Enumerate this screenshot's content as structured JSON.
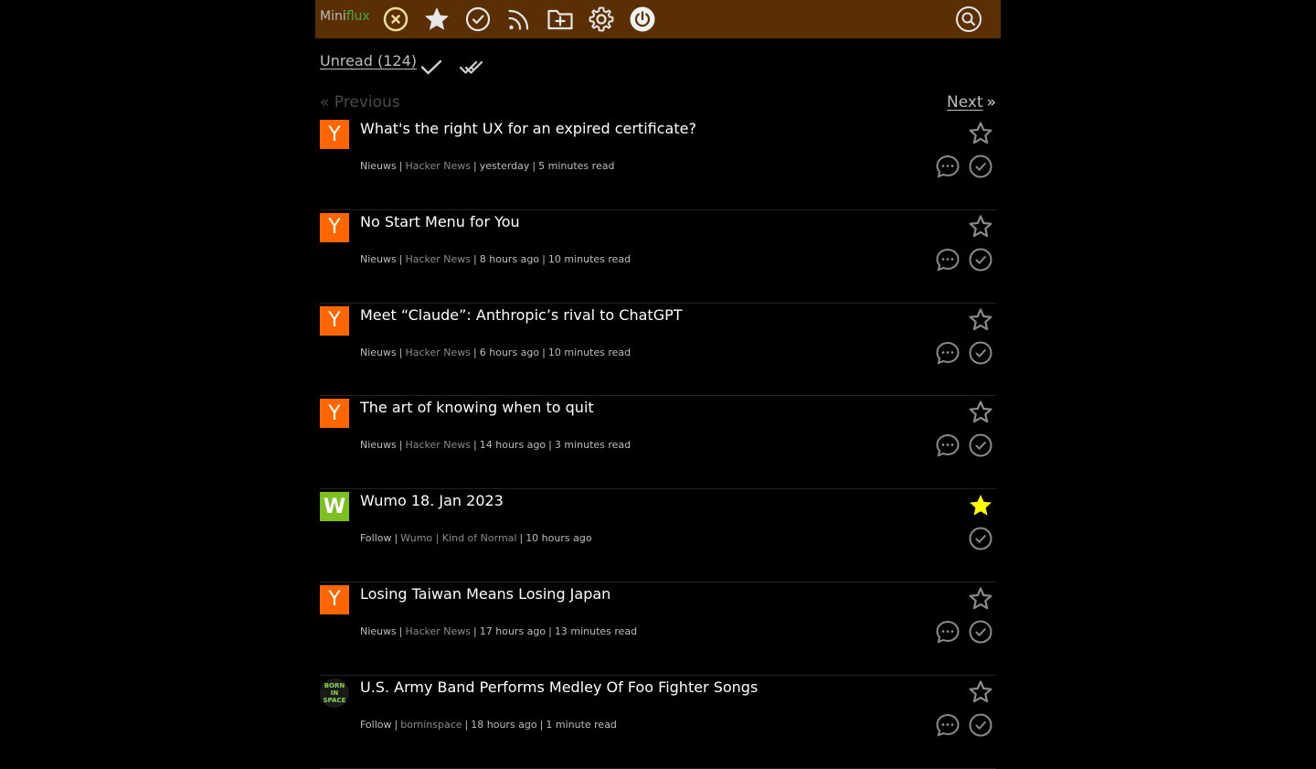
{
  "app": {
    "logo_part1": "Mini",
    "logo_part2": "flux"
  },
  "nav": [
    {
      "name": "unread-icon"
    },
    {
      "name": "starred-icon"
    },
    {
      "name": "history-icon"
    },
    {
      "name": "feeds-icon"
    },
    {
      "name": "categories-icon"
    },
    {
      "name": "settings-icon"
    },
    {
      "name": "logout-icon"
    },
    {
      "name": "search-icon"
    }
  ],
  "subbar": {
    "unread_label": "Unread (124)"
  },
  "pager": {
    "previous": "« Previous",
    "next": "Next",
    "next_arrow": "»"
  },
  "colors": {
    "topbar": "#5a2f03",
    "star_active": "#ffff00",
    "icon_gray": "#8a8a8a"
  },
  "entries": [
    {
      "title": "What's the right UX for an expired certificate?",
      "category": "Nieuws",
      "feed": "Hacker News",
      "time": "yesterday",
      "read_time": "5 minutes read",
      "icon": "Y",
      "starred": false,
      "comments": true
    },
    {
      "title": "No Start Menu for You",
      "category": "Nieuws",
      "feed": "Hacker News",
      "time": "8 hours ago",
      "read_time": "10 minutes read",
      "icon": "Y",
      "starred": false,
      "comments": true
    },
    {
      "title": "Meet “Claude”: Anthropic’s rival to ChatGPT",
      "category": "Nieuws",
      "feed": "Hacker News",
      "time": "6 hours ago",
      "read_time": "10 minutes read",
      "icon": "Y",
      "starred": false,
      "comments": true
    },
    {
      "title": "The art of knowing when to quit",
      "category": "Nieuws",
      "feed": "Hacker News",
      "time": "14 hours ago",
      "read_time": "3 minutes read",
      "icon": "Y",
      "starred": false,
      "comments": true
    },
    {
      "title": "Wumo 18. Jan 2023",
      "category": "Follow",
      "feed": "Wumo | Kind of Normal",
      "time": "10 hours ago",
      "read_time": "",
      "icon": "W",
      "starred": true,
      "comments": false
    },
    {
      "title": "Losing Taiwan Means Losing Japan",
      "category": "Nieuws",
      "feed": "Hacker News",
      "time": "17 hours ago",
      "read_time": "13 minutes read",
      "icon": "Y",
      "starred": false,
      "comments": true
    },
    {
      "title": "U.S. Army Band Performs Medley Of Foo Fighter Songs",
      "category": "Follow",
      "feed": "borninspace",
      "time": "18 hours ago",
      "read_time": "1 minute read",
      "icon": "BORN IN SPACE",
      "starred": false,
      "comments": true
    }
  ]
}
